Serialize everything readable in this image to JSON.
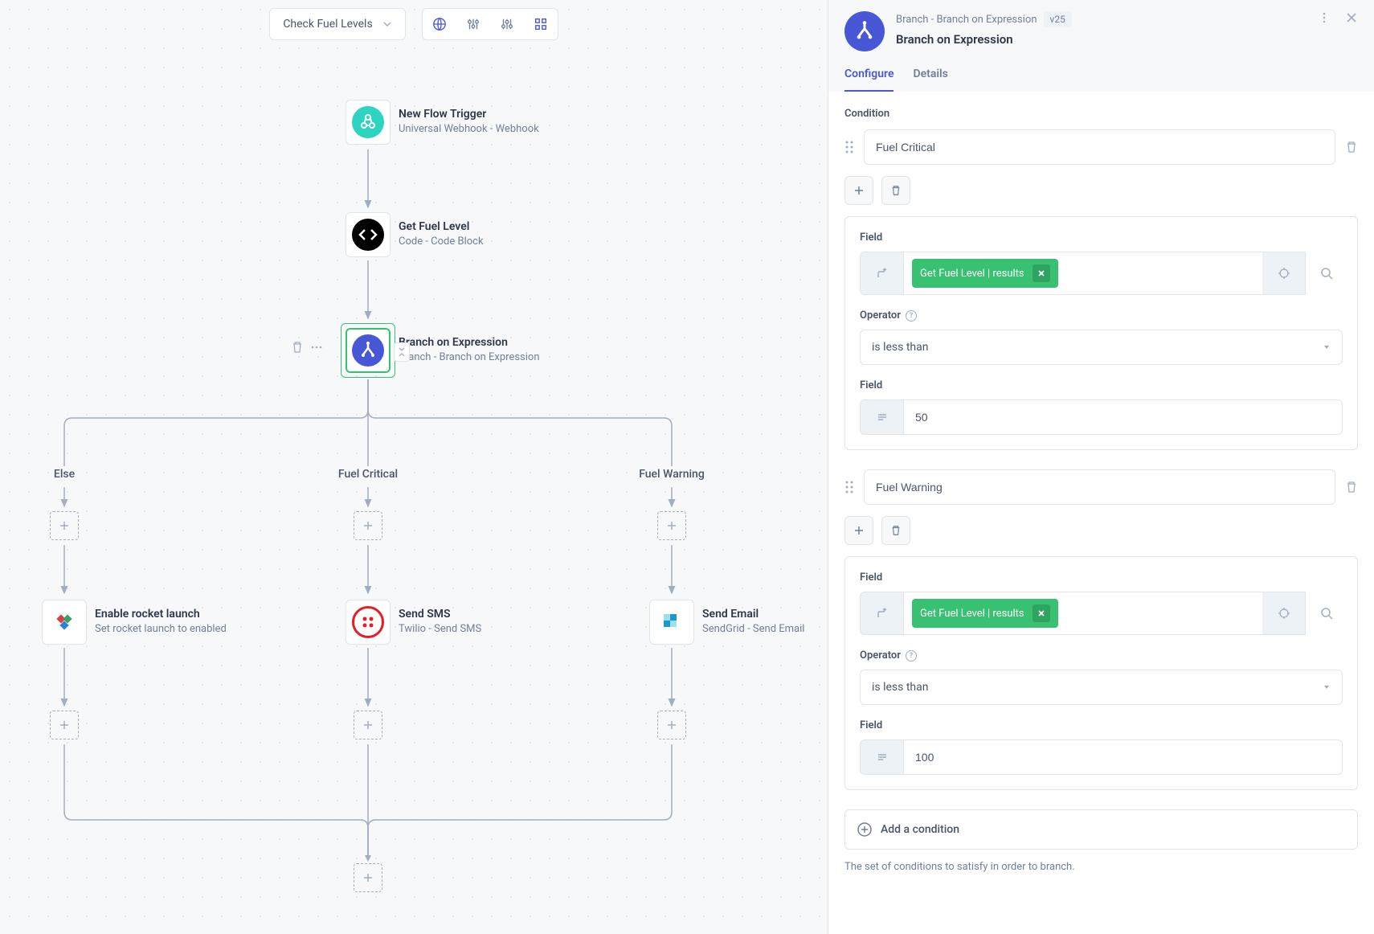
{
  "toolbar": {
    "flow_name": "Check Fuel Levels"
  },
  "nodes": {
    "trigger": {
      "title": "New Flow Trigger",
      "subtitle": "Universal Webhook - Webhook"
    },
    "fuel": {
      "title": "Get Fuel Level",
      "subtitle": "Code - Code Block"
    },
    "branch": {
      "title": "Branch on Expression",
      "subtitle": "Branch - Branch on Expression"
    },
    "rocket": {
      "title": "Enable rocket launch",
      "subtitle": "Set rocket launch to enabled"
    },
    "sms": {
      "title": "Send SMS",
      "subtitle": "Twilio - Send SMS"
    },
    "email": {
      "title": "Send Email",
      "subtitle": "SendGrid - Send Email"
    }
  },
  "branches": {
    "else": "Else",
    "critical": "Fuel Critical",
    "warning": "Fuel Warning"
  },
  "panel": {
    "breadcrumb": "Branch - Branch on Expression",
    "version": "v25",
    "title": "Branch on Expression",
    "tabs": {
      "configure": "Configure",
      "details": "Details"
    },
    "condition_label": "Condition",
    "conditions": [
      {
        "name": "Fuel Critical",
        "field_label": "Field",
        "pill": "Get Fuel Level | results",
        "operator_label": "Operator",
        "operator": "is less than",
        "value_label": "Field",
        "value": "50"
      },
      {
        "name": "Fuel Warning",
        "field_label": "Field",
        "pill": "Get Fuel Level | results",
        "operator_label": "Operator",
        "operator": "is less than",
        "value_label": "Field",
        "value": "100"
      }
    ],
    "add_condition": "Add a condition",
    "help_text": "The set of conditions to satisfy in order to branch."
  }
}
